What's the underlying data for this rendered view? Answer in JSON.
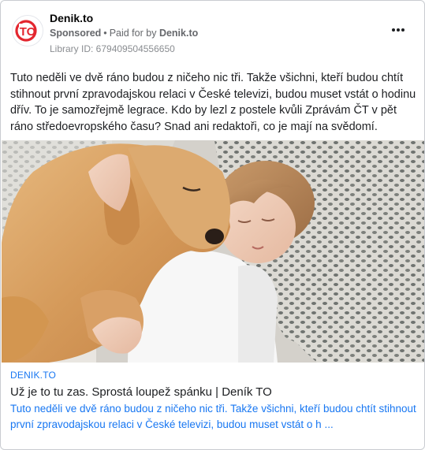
{
  "advertiser": {
    "name": "Denik.to",
    "logo_text": "TO",
    "sponsored_label": "Sponsored",
    "paid_for_label": "Paid for by",
    "paid_for_name": "Denik.to",
    "library_id": "Library ID: 679409504556650"
  },
  "menu": {
    "icon": "more-horizontal-icon"
  },
  "post": {
    "text": "Tuto neděli ve dvě ráno budou z ničeho nic tři. Takže všichni, kteří budou chtít stihnout první zpravodajskou relaci v České televizi, budou muset vstát o hodinu dřív. To je samozřejmě legrace. Kdo by lezl z postele kvůli Zprávám ČT v pět ráno středoevropského času? Snad ani redaktoři, co je mají na svědomí."
  },
  "image": {
    "description_icon": "photo-girl-sleeping-with-golden-retriever"
  },
  "link": {
    "domain": "DENIK.TO",
    "title": "Už je to tu zas. Sprostá loupež spánku | Deník TO",
    "description": "Tuto neděli ve dvě ráno budou z ničeho nic tři. Takže všichni, kteří budou chtít stihnout první zpravodajskou relaci v České televizi, budou muset vstát o h ..."
  },
  "colors": {
    "brand_red": "#e3262f",
    "link_blue": "#1877f2",
    "muted": "#65676b"
  }
}
